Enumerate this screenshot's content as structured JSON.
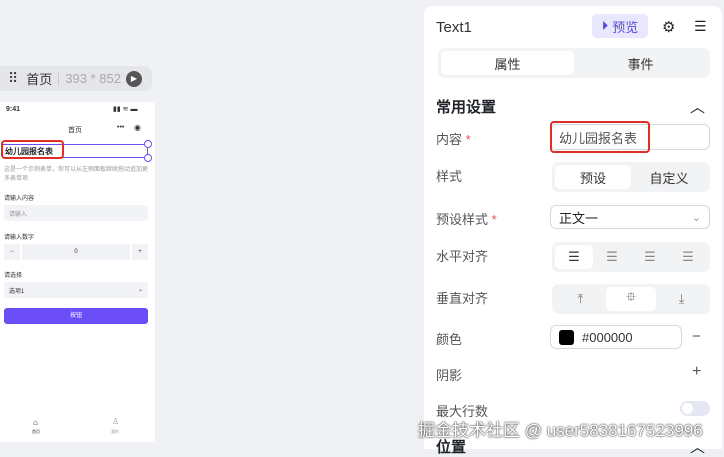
{
  "toolbar": {
    "page": "首页",
    "size": "393 * 852"
  },
  "phone": {
    "time": "9:41",
    "nav_title": "首页",
    "title": "幼儿园报名表",
    "desc": "这是一个示例表单，你可以从左侧面板继续拖动追加更多表单项",
    "label1": "请输入内容",
    "placeholder1": "请输入",
    "label2": "请输入数字",
    "stepper_minus": "−",
    "stepper_value": "0",
    "stepper_plus": "+",
    "label3": "请选择",
    "select_value": "选项1",
    "button": "按钮",
    "tab_home": "首页",
    "tab_me": "我的"
  },
  "panel": {
    "title": "Text1",
    "preview": "预览",
    "tabs": [
      "属性",
      "事件"
    ],
    "section": "常用设置",
    "content_label": "内容",
    "content_value": "幼儿园报名表",
    "style_label": "样式",
    "style_options": [
      "预设",
      "自定义"
    ],
    "preset_label": "预设样式",
    "preset_value": "正文一",
    "halign_label": "水平对齐",
    "valign_label": "垂直对齐",
    "color_label": "颜色",
    "color_value": "#000000",
    "shadow_label": "阴影",
    "maxlines_label": "最大行数",
    "position_section": "位置"
  },
  "watermark": "掘金技术社区 @ user5838167523996",
  "colors": {
    "accent": "#6b4ef6",
    "highlight": "#e02e24"
  }
}
